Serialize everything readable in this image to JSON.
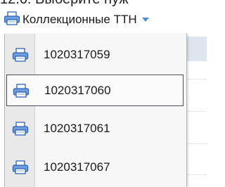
{
  "heading_partial": "12.6. Выберите нуж",
  "toolbar": {
    "label": "Коллекционные ТТН",
    "icon": "printer-icon",
    "dropdown_icon": "chevron-down-icon",
    "accent_color": "#4a8fd6"
  },
  "menu": {
    "items": [
      {
        "label": "1020317059",
        "icon": "printer-icon",
        "selected": false
      },
      {
        "label": "1020317060",
        "icon": "printer-icon",
        "selected": true
      },
      {
        "label": "1020317061",
        "icon": "printer-icon",
        "selected": false
      },
      {
        "label": "1020317067",
        "icon": "printer-icon",
        "selected": false
      }
    ]
  }
}
